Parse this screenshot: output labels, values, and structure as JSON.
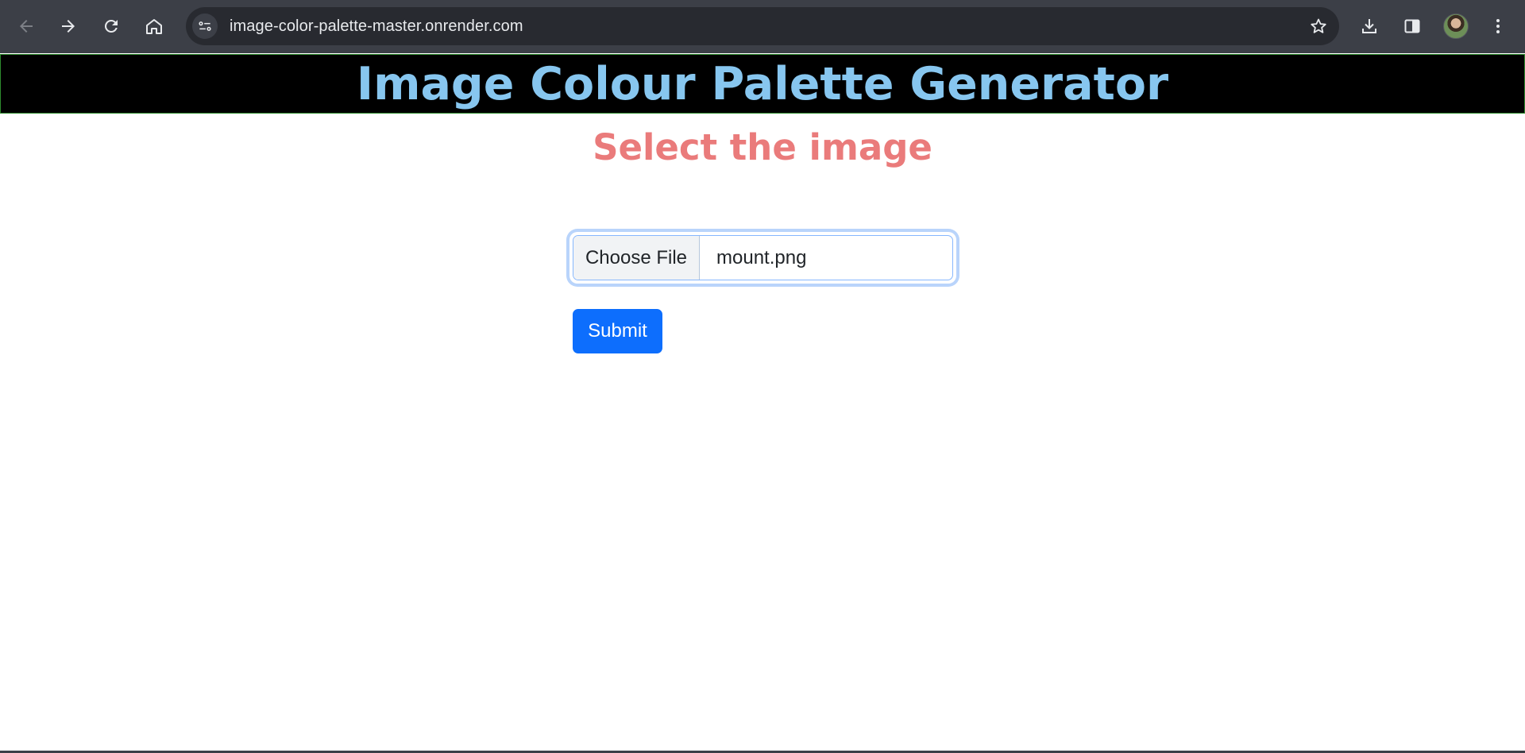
{
  "browser": {
    "url": "image-color-palette-master.onrender.com",
    "icons": [
      "back-arrow-icon",
      "forward-arrow-icon",
      "reload-icon",
      "home-icon",
      "site-info-icon",
      "bookmark-star-icon",
      "download-icon",
      "side-panel-icon",
      "profile-avatar",
      "more-menu-icon"
    ]
  },
  "page": {
    "title": "Image Colour Palette Generator",
    "subtitle": "Select the image",
    "file_input": {
      "button_label": "Choose File",
      "file_name": "mount.png"
    },
    "submit_label": "Submit"
  },
  "colors": {
    "title": "#87c6ef",
    "subtitle": "#ea7b7b",
    "submit_button": "#0d6efd",
    "header_background": "#000000"
  }
}
